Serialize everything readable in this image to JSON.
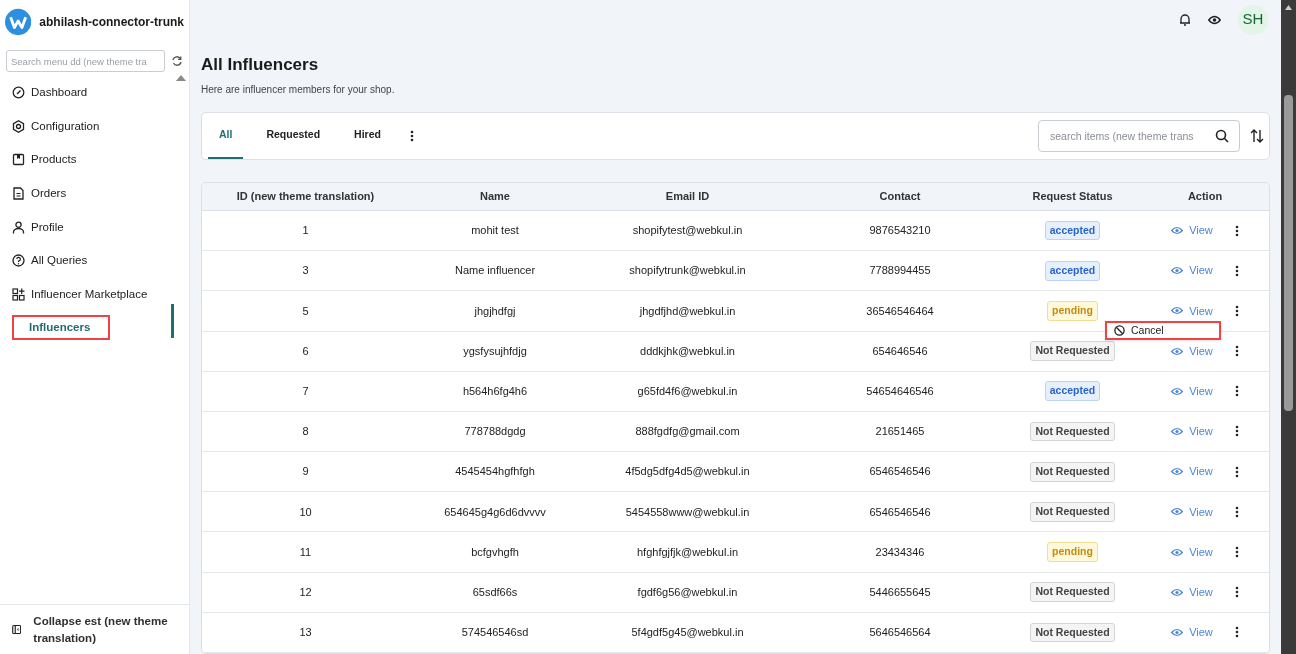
{
  "app": {
    "name": "abhilash-connector-trunk"
  },
  "sidebar": {
    "search_placeholder": "Search menu dd (new theme tra",
    "items": [
      {
        "label": "Dashboard",
        "kind": "dashboard",
        "selected": false
      },
      {
        "label": "Configuration",
        "kind": "config",
        "selected": false
      },
      {
        "label": "Products",
        "kind": "products",
        "selected": false
      },
      {
        "label": "Orders",
        "kind": "orders",
        "selected": false
      },
      {
        "label": "Profile",
        "kind": "profile",
        "selected": false
      },
      {
        "label": "All Queries",
        "kind": "queries",
        "selected": false
      },
      {
        "label": "Influencer Marketplace",
        "kind": "marketplace",
        "selected": false,
        "children": [
          {
            "label": "Influencers",
            "selected": true
          }
        ]
      }
    ],
    "collapse_label": "Collapse est (new theme translation)"
  },
  "header": {
    "avatar": "SH"
  },
  "page": {
    "title": "All Influencers",
    "subtitle": "Here are influencer members for your shop."
  },
  "tabs": [
    {
      "label": "All",
      "selected": true
    },
    {
      "label": "Requested",
      "selected": false
    },
    {
      "label": "Hired",
      "selected": false
    }
  ],
  "search": {
    "placeholder": "search items (new theme trans"
  },
  "table": {
    "columns": [
      "ID (new theme translation)",
      "Name",
      "Email ID",
      "Contact",
      "Request Status",
      "Action"
    ],
    "rows": [
      {
        "id": "1",
        "name": "mohit test",
        "email": "shopifytest@webkul.in",
        "contact": "9876543210",
        "status": "accepted",
        "kind": "accepted",
        "action": "View",
        "menu_open": false
      },
      {
        "id": "3",
        "name": "Name influencer",
        "email": "shopifytrunk@webkul.in",
        "contact": "7788994455",
        "status": "accepted",
        "kind": "accepted",
        "action": "View",
        "menu_open": false
      },
      {
        "id": "5",
        "name": "jhgjhdfgj",
        "email": "jhgdfjhd@webkul.in",
        "contact": "36546546464",
        "status": "pending",
        "kind": "pending",
        "action": "View",
        "menu_open": true
      },
      {
        "id": "6",
        "name": "ygsfysujhfdjg",
        "email": "dddkjhk@webkul.in",
        "contact": "654646546",
        "status": "Not Requested",
        "kind": "none",
        "action": "View",
        "menu_open": false
      },
      {
        "id": "7",
        "name": "h564h6fg4h6",
        "email": "g65fd4f6@webkul.in",
        "contact": "54654646546",
        "status": "accepted",
        "kind": "accepted",
        "action": "View",
        "menu_open": false
      },
      {
        "id": "8",
        "name": "778788dgdg",
        "email": "888fgdfg@gmail.com",
        "contact": "21651465",
        "status": "Not Requested",
        "kind": "none",
        "action": "View",
        "menu_open": false
      },
      {
        "id": "9",
        "name": "4545454hgfhfgh",
        "email": "4f5dg5dfg4d5@webkul.in",
        "contact": "6546546546",
        "status": "Not Requested",
        "kind": "none",
        "action": "View",
        "menu_open": false
      },
      {
        "id": "10",
        "name": "654645g4g6d6dvvvv",
        "email": "5454558www@webkul.in",
        "contact": "6546546546",
        "status": "Not Requested",
        "kind": "none",
        "action": "View",
        "menu_open": false
      },
      {
        "id": "11",
        "name": "bcfgvhgfh",
        "email": "hfghfgjfjk@webkul.in",
        "contact": "23434346",
        "status": "pending",
        "kind": "pending",
        "action": "View",
        "menu_open": false
      },
      {
        "id": "12",
        "name": "65sdf66s",
        "email": "fgdf6g56@webkul.in",
        "contact": "5446655645",
        "status": "Not Requested",
        "kind": "none",
        "action": "View",
        "menu_open": false
      },
      {
        "id": "13",
        "name": "574546546sd",
        "email": "5f4gdf5g45@webkul.in",
        "contact": "5646546564",
        "status": "Not Requested",
        "kind": "none",
        "action": "View",
        "menu_open": false
      }
    ]
  },
  "row_menu": {
    "items": [
      "Cancel"
    ]
  }
}
